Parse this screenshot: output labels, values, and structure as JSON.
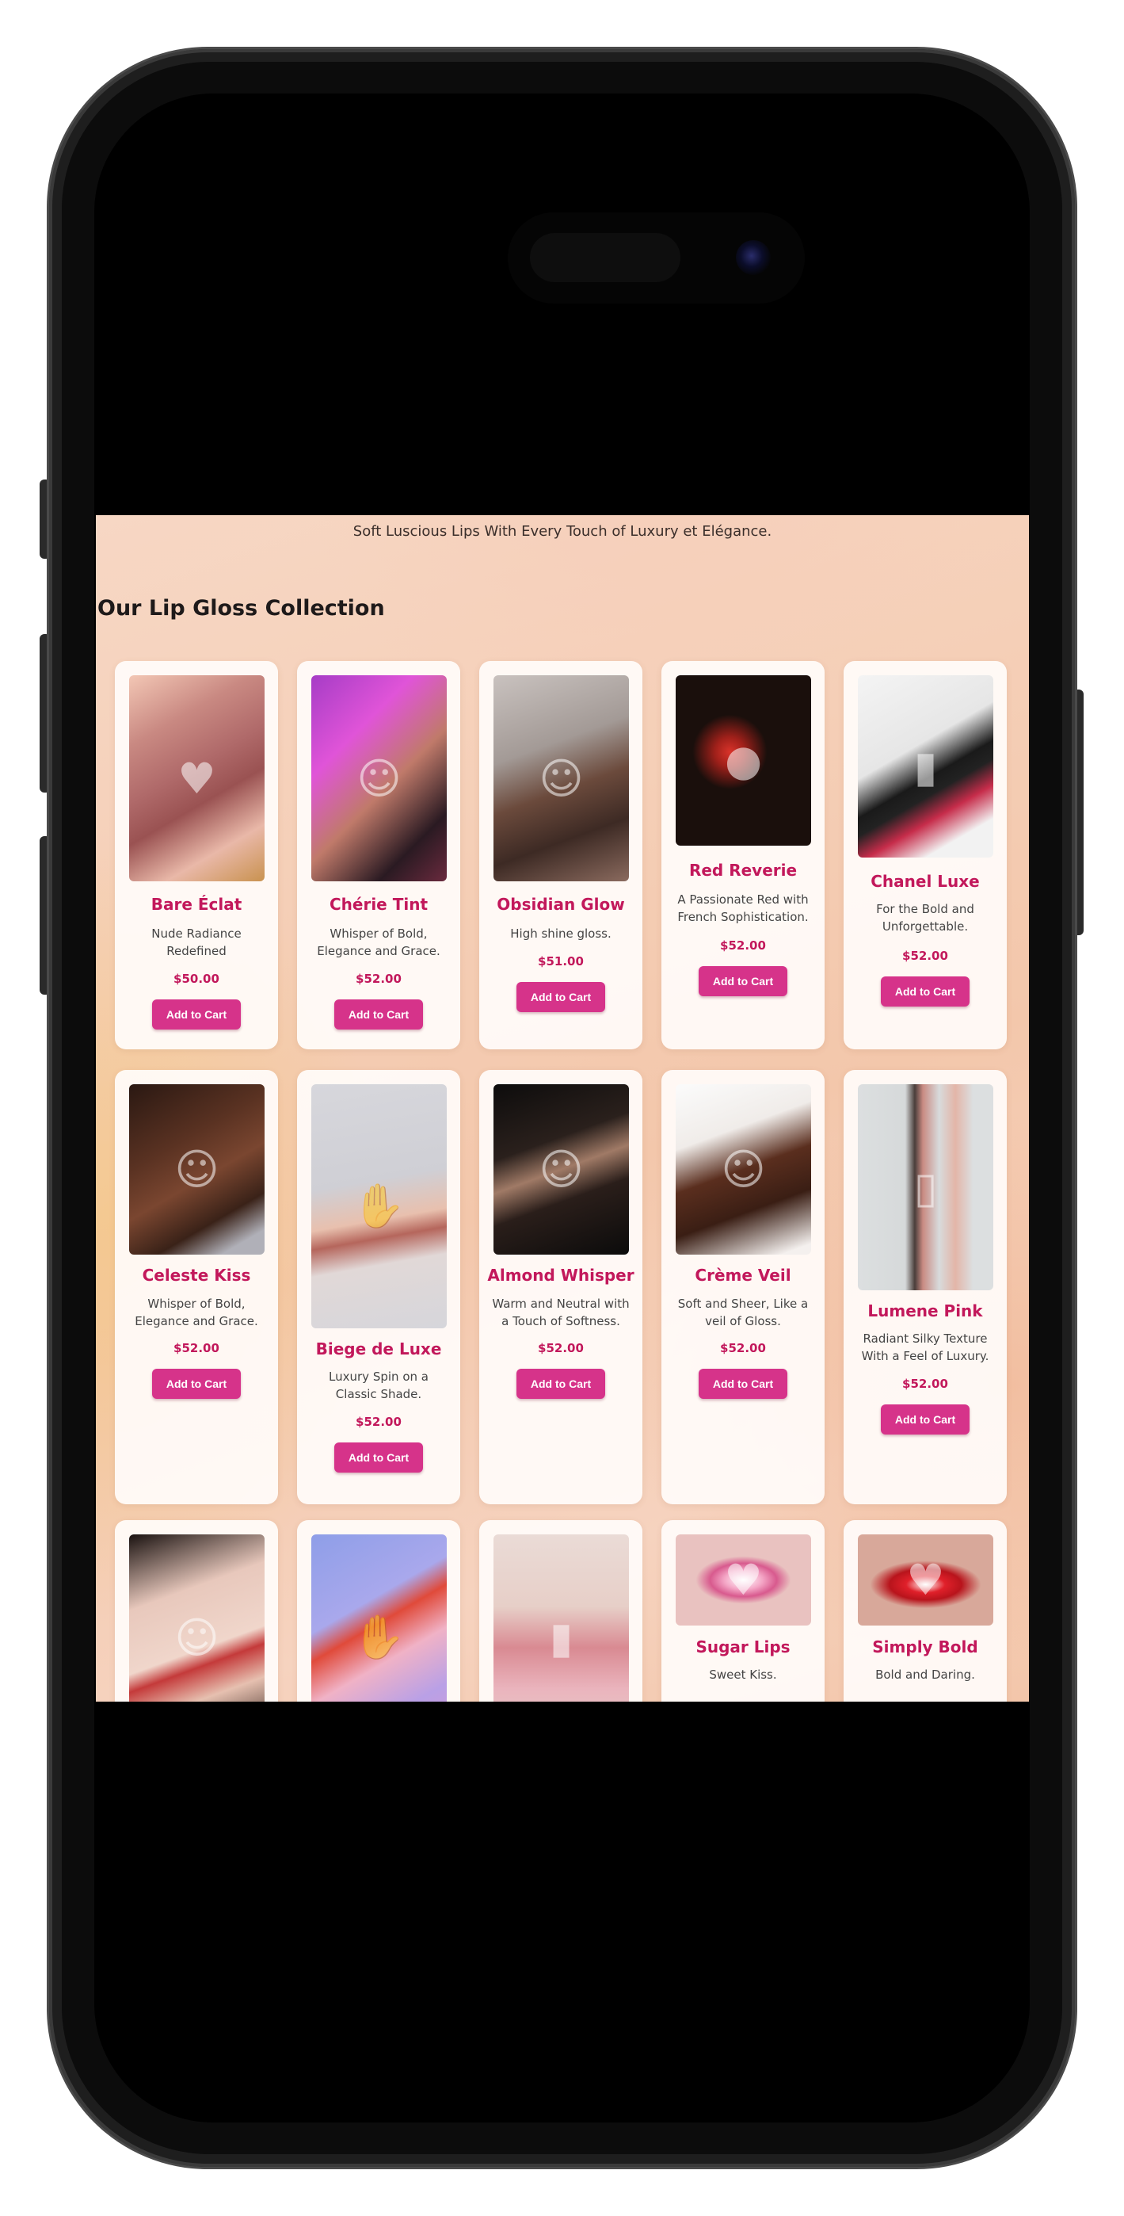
{
  "page": {
    "tagline": "Soft Luscious Lips With Every Touch of Luxury et Elégance.",
    "section_title": "Our Lip Gloss Collection"
  },
  "colors": {
    "accent": "#d6338a",
    "product_name": "#c2185b",
    "card_background": "#fffcfa"
  },
  "products": [
    {
      "name": "Bare Éclat",
      "description": "Nude Radiance Redefined",
      "price": "$50.00",
      "button": "Add to Cart"
    },
    {
      "name": "Chérie Tint",
      "description": "Whisper of Bold, Elegance and Grace.",
      "price": "$52.00",
      "button": "Add to Cart"
    },
    {
      "name": "Obsidian Glow",
      "description": "High shine gloss.",
      "price": "$51.00",
      "button": "Add to Cart"
    },
    {
      "name": "Red Reverie",
      "description": "A Passionate Red with French Sophistication.",
      "price": "$52.00",
      "button": "Add to Cart"
    },
    {
      "name": "Chanel Luxe",
      "description": "For the Bold and Unforgettable.",
      "price": "$52.00",
      "button": "Add to Cart"
    },
    {
      "name": "Celeste Kiss",
      "description": "Whisper of Bold, Elegance and Grace.",
      "price": "$52.00",
      "button": "Add to Cart"
    },
    {
      "name": "Biege de Luxe",
      "description": "Luxury Spin on a Classic Shade.",
      "price": "$52.00",
      "button": "Add to Cart"
    },
    {
      "name": "Almond Whisper",
      "description": "Warm and Neutral with a Touch of Softness.",
      "price": "$52.00",
      "button": "Add to Cart"
    },
    {
      "name": "Crème Veil",
      "description": "Soft and Sheer, Like a veil of Gloss.",
      "price": "$52.00",
      "button": "Add to Cart"
    },
    {
      "name": "Lumene Pink",
      "description": "Radiant Silky Texture With a Feel of Luxury.",
      "price": "$52.00",
      "button": "Add to Cart"
    },
    {
      "name": "",
      "description": "",
      "price": "",
      "button": ""
    },
    {
      "name": "",
      "description": "",
      "price": "",
      "button": ""
    },
    {
      "name": "",
      "description": "",
      "price": "",
      "button": ""
    },
    {
      "name": "Sugar Lips",
      "description": "Sweet Kiss.",
      "price": "",
      "button": ""
    },
    {
      "name": "Simply Bold",
      "description": "Bold and Daring.",
      "price": "",
      "button": ""
    }
  ]
}
